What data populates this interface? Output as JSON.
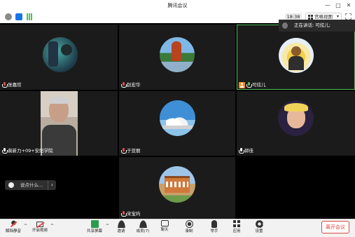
{
  "window": {
    "title": "腾讯会议",
    "minimize": "—",
    "maximize": "□",
    "close": "✕"
  },
  "status": {
    "timer": "18:38",
    "view_label": "宫格视图",
    "speaking_label": "正在讲话: 可炫儿;"
  },
  "participants": [
    {
      "name": "张嘉欣",
      "mic": "muted"
    },
    {
      "name": "赵宏华",
      "mic": "muted"
    },
    {
      "name": "可炫儿",
      "mic": "green",
      "host": true
    },
    {
      "name": "裴新力+09+安阳学院",
      "mic": "on"
    },
    {
      "name": "于亚丽",
      "mic": "muted"
    },
    {
      "name": "郭佳",
      "mic": "on"
    },
    {
      "name": "宋宝玙",
      "mic": "muted"
    }
  ],
  "chat": {
    "placeholder": "说点什么..."
  },
  "toolbar": {
    "unmute": "解除静音",
    "video": "开启视频",
    "share": "共享屏幕",
    "invite": "邀请",
    "members": "成员(7)",
    "chat": "聊天",
    "record": "录制",
    "raise_hand": "举手",
    "apps": "应用",
    "settings": "设置",
    "leave": "离开会议"
  },
  "colors": {
    "accent": "#1a73e8",
    "active_speaker": "#4ec05b",
    "leave": "#e0443a",
    "muted": "#e84a4a"
  }
}
